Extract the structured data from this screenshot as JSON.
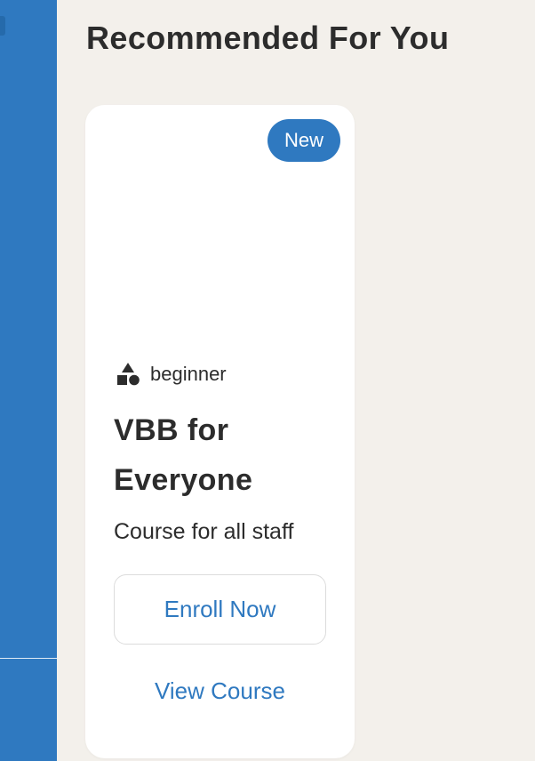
{
  "page": {
    "title": "Recommended For You"
  },
  "sidebar": {
    "color": "#2f79c0"
  },
  "course_card": {
    "badge": "New",
    "level_icon": "shapes-icon",
    "level": "beginner",
    "title": "VBB for Everyone",
    "description": "Course for all staff",
    "enroll_label": "Enroll Now",
    "view_label": "View Course"
  },
  "colors": {
    "accent": "#2f79c0",
    "page_background": "#f3f0eb",
    "card_background": "#ffffff",
    "text": "#2c2c2c"
  }
}
